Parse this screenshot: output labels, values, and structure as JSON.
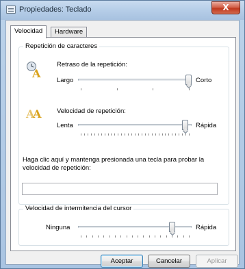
{
  "window": {
    "title": "Propiedades: Teclado",
    "close_symbol": "X"
  },
  "tabs": [
    {
      "label": "Velocidad",
      "active": true
    },
    {
      "label": "Hardware",
      "active": false
    }
  ],
  "repetition_group": {
    "legend": "Repetición de caracteres",
    "delay": {
      "label": "Retraso de la repetición:",
      "min_label": "Largo",
      "max_label": "Corto",
      "level": 1.0
    },
    "rate": {
      "label": "Velocidad de repetición:",
      "min_label": "Lenta",
      "max_label": "Rápida",
      "level": 0.97
    },
    "test_prompt": "Haga clic aquí y mantenga presionada una tecla para probar la velocidad de repetición:",
    "test_value": ""
  },
  "blink_group": {
    "legend": "Velocidad de intermitencia del cursor",
    "min_label": "Ninguna",
    "max_label": "Rápida",
    "level": 0.85
  },
  "buttons": {
    "ok": "Aceptar",
    "cancel": "Cancelar",
    "apply": "Aplicar"
  },
  "icons": {
    "delay": "keyboard-delay-clock-icon",
    "rate": "keyboard-repeat-rate-icon",
    "window": "keyboard-window-icon"
  }
}
